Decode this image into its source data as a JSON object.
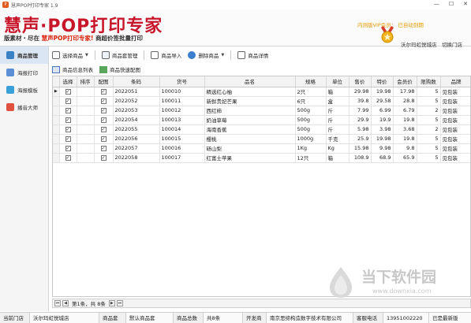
{
  "window": {
    "title": "慧声POP打印专家 1.9",
    "min_label": "—",
    "max_label": "☐",
    "close_label": "✕"
  },
  "banner": {
    "logo_text": "慧声·POP打印专家",
    "slogan_prefix": "版素材・尽在",
    "slogan_highlight": "慧声POP打印专家!",
    "slogan_suffix": "商超价签批量打印",
    "vip_label": "内测版VIP会员：",
    "vip_expiry": "已自动到期",
    "store_name": "沃尔玛虹悦城店",
    "switch_store": "切换门店"
  },
  "sidebar": {
    "items": [
      {
        "label": "商品管理",
        "active": true
      },
      {
        "label": "海报打印",
        "active": false
      },
      {
        "label": "海报模板",
        "active": false
      },
      {
        "label": "播音大师",
        "active": false
      }
    ]
  },
  "toolbar": {
    "select_goods": "选择商品",
    "goods_set": "商品套管理",
    "import": "商品导入",
    "delete": "删除商品",
    "detail": "商品详情"
  },
  "subtabs": {
    "info_list": "商品信息列表",
    "quick_config": "商品快速配图"
  },
  "table": {
    "columns": [
      "选择",
      "排序",
      "配图",
      "条码",
      "货号",
      "品名",
      "规格",
      "单位",
      "售价",
      "特价",
      "会员价",
      "限购数",
      "品牌"
    ],
    "rows": [
      {
        "select": "✓",
        "order": "",
        "pic": "✓",
        "barcode": "2022051",
        "sku": "100010",
        "name": "精选红心柚",
        "spec": "2只",
        "unit": "箱",
        "price": "29.98",
        "special": "19.98",
        "member": "17.98",
        "limit": "5",
        "brand": "见包装"
      },
      {
        "select": "✓",
        "order": "",
        "pic": "✓",
        "barcode": "2022052",
        "sku": "100011",
        "name": "新鲜贵妃芒果",
        "spec": "6只",
        "unit": "盒",
        "price": "39.8",
        "special": "29.58",
        "member": "28.8",
        "limit": "5",
        "brand": "见包装"
      },
      {
        "select": "✓",
        "order": "",
        "pic": "✓",
        "barcode": "2022053",
        "sku": "100012",
        "name": "西红柿",
        "spec": "500g",
        "unit": "斤",
        "price": "7.99",
        "special": "6.99",
        "member": "6.79",
        "limit": "2",
        "brand": "见包装"
      },
      {
        "select": "✓",
        "order": "",
        "pic": "✓",
        "barcode": "2022054",
        "sku": "100013",
        "name": "奶油草莓",
        "spec": "500g",
        "unit": "斤",
        "price": "29.9",
        "special": "19.9",
        "member": "19.8",
        "limit": "5",
        "brand": "见包装"
      },
      {
        "select": "✓",
        "order": "",
        "pic": "✓",
        "barcode": "2022055",
        "sku": "100014",
        "name": "海南香蕉",
        "spec": "500g",
        "unit": "斤",
        "price": "5.98",
        "special": "3.98",
        "member": "3.68",
        "limit": "2",
        "brand": "见包装"
      },
      {
        "select": "✓",
        "order": "",
        "pic": "✓",
        "barcode": "2022056",
        "sku": "100015",
        "name": "樱桃",
        "spec": "1000g",
        "unit": "千克",
        "price": "25.9",
        "special": "19.98",
        "member": "19.8",
        "limit": "5",
        "brand": "见包装"
      },
      {
        "select": "✓",
        "order": "",
        "pic": "✓",
        "barcode": "2022057",
        "sku": "100016",
        "name": "砀山梨",
        "spec": "1Kg",
        "unit": "Kg",
        "price": "15.98",
        "special": "9.98",
        "member": "9.8",
        "limit": "5",
        "brand": "见包装"
      },
      {
        "select": "✓",
        "order": "",
        "pic": "✓",
        "barcode": "2022058",
        "sku": "100017",
        "name": "红富士苹果",
        "spec": "12只",
        "unit": "箱",
        "price": "108.9",
        "special": "68.9",
        "member": "65.9",
        "limit": "5",
        "brand": "见包装"
      }
    ]
  },
  "pager": {
    "first": "⏮",
    "prev": "◀",
    "info": "第1条，共 8条",
    "next": "▶",
    "last": "⏭"
  },
  "watermark": {
    "cn": "当下软件园",
    "url": "www.downxia.com"
  },
  "statusbar": {
    "store_label": "当前门店",
    "store_value": "沃尔玛虹悦城店",
    "set_label": "商品套",
    "set_value": "默认商品套",
    "count_label": "商品总数",
    "count_value": "共8条",
    "dev_label": "开发商",
    "dev_value": "南京思缔构造数字技术有限公司",
    "phone_label": "客服电话",
    "phone_value": "13951002220",
    "version_value": "已是最新版"
  },
  "colors": {
    "logo_red": "#c7162a",
    "highlight_red": "#d81e06",
    "vip_orange": "#e89a00",
    "sidebar_active": "#dbe6f4"
  }
}
